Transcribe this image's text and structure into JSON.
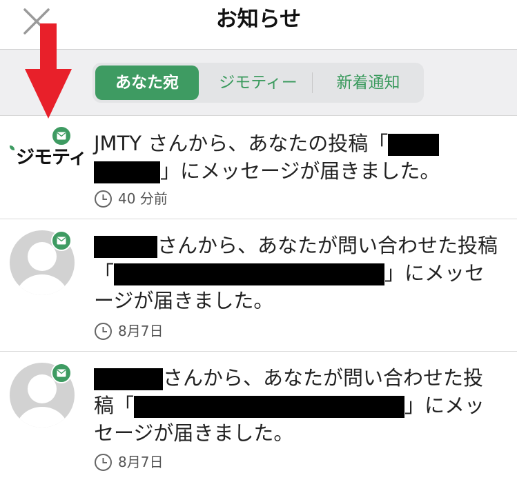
{
  "header": {
    "title": "お知らせ",
    "close_icon": "close-icon"
  },
  "tabs": [
    {
      "label": "あなた宛",
      "active": true
    },
    {
      "label": "ジモティー",
      "active": false
    },
    {
      "label": "新着通知",
      "active": false
    }
  ],
  "colors": {
    "accent": "#3e9b62",
    "arrow": "#e8202a"
  },
  "notifications": [
    {
      "logo": "ジモティ",
      "text_prefix": "JMTY さんから、あなたの投稿「",
      "text_suffix": "」にメッセージが届きました。",
      "time": "40 分前",
      "icon": "mail-icon"
    },
    {
      "text_prefix": "さんから、あなたが問い合わせた投稿「",
      "text_suffix": "」にメッセージが届きました。",
      "time": "8月7日",
      "icon": "mail-icon"
    },
    {
      "text_prefix": "さんから、あなたが問い合わせた投稿「",
      "text_suffix": "」にメッセージが届きました。",
      "time": "8月7日",
      "icon": "mail-icon"
    }
  ]
}
